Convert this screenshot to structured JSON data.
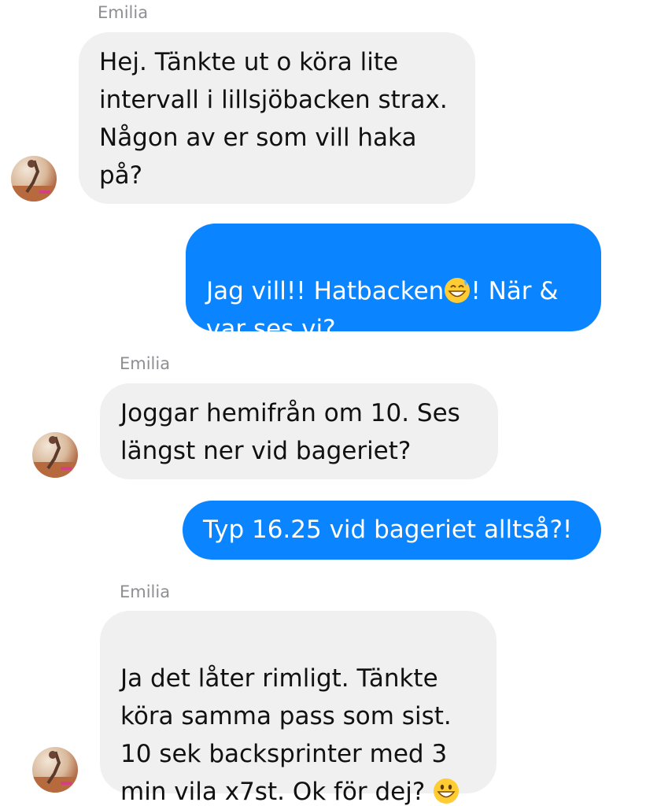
{
  "conversation": {
    "messages": [
      {
        "sender": "Emilia",
        "text": "Hej. Tänkte ut o köra lite\nintervall i lillsjöbacken strax.\nNågon av er som vill haka\npå?"
      },
      {
        "sender": "me",
        "text_before_emoji": "Jag vill!! Hatbacken",
        "emoji": "grinning-sweat-emoji",
        "text_after_emoji": "! När &\nvar ses vi?"
      },
      {
        "sender": "Emilia",
        "text": "Joggar hemifrån om 10. Ses\nlängst ner vid bageriet?"
      },
      {
        "sender": "me",
        "text": "Typ 16.25 vid bageriet alltså?!"
      },
      {
        "sender": "Emilia",
        "text_before_emoji": "Ja det låter rimligt. Tänkte\nköra samma pass som sist.\n10 sek backsprinter med 3\nmin vila x7st. Ok för dej? ",
        "emoji": "grinning-emoji"
      }
    ]
  },
  "colors": {
    "incoming_bubble": "#f0f0f0",
    "outgoing_bubble": "#0a84ff",
    "sender_label": "#8e8e93"
  }
}
